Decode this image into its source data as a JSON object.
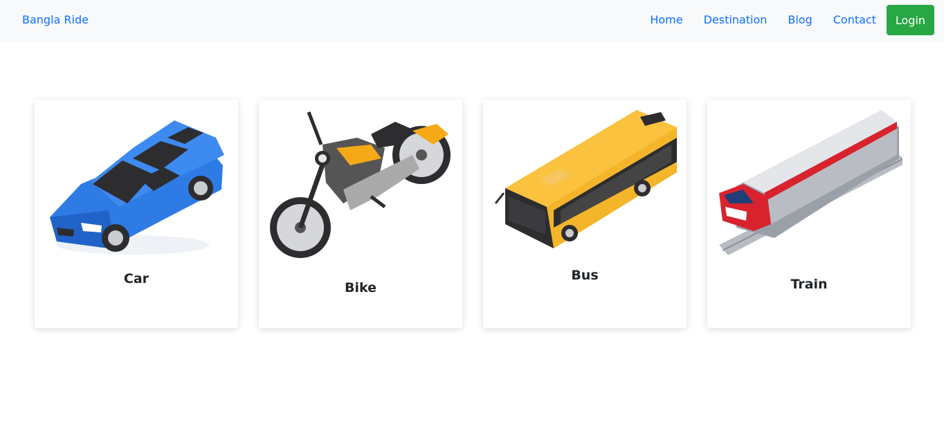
{
  "navbar": {
    "brand": "Bangla Ride",
    "links": [
      "Home",
      "Destination",
      "Blog",
      "Contact"
    ],
    "login_label": "Login"
  },
  "cards": [
    {
      "title": "Car",
      "icon": "car-icon"
    },
    {
      "title": "Bike",
      "icon": "motorcycle-icon"
    },
    {
      "title": "Bus",
      "icon": "bus-icon"
    },
    {
      "title": "Train",
      "icon": "train-icon"
    }
  ],
  "colors": {
    "link": "#0d6efd",
    "login_button": "#28a745",
    "navbar_bg": "#f8f9fa",
    "title_text": "#212529"
  }
}
